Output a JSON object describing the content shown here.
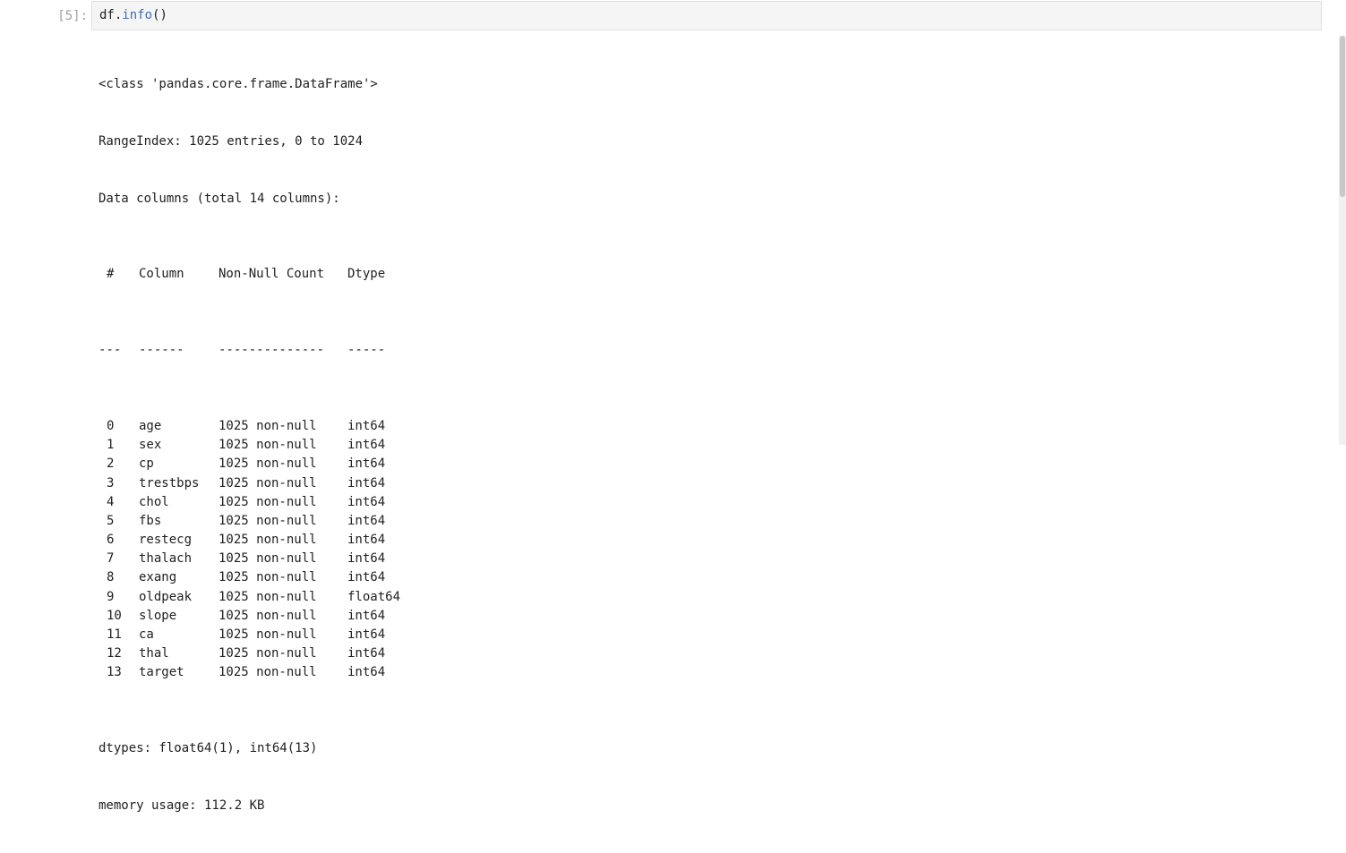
{
  "cell": {
    "prompt": "[5]:",
    "code": {
      "object": "df",
      "dot": ".",
      "method": "info",
      "parens": "()"
    }
  },
  "output": {
    "class_line": "<class 'pandas.core.frame.DataFrame'>",
    "range_line": "RangeIndex: 1025 entries, 0 to 1024",
    "columns_line": "Data columns (total 14 columns):",
    "headers": {
      "num": "#",
      "column": "Column",
      "count": "Non-Null Count",
      "dtype": "Dtype"
    },
    "separators": {
      "num": "---",
      "column": "------",
      "count": "--------------",
      "dtype": "-----"
    },
    "rows": [
      {
        "num": "0",
        "column": "age",
        "count": "1025 non-null",
        "dtype": "int64"
      },
      {
        "num": "1",
        "column": "sex",
        "count": "1025 non-null",
        "dtype": "int64"
      },
      {
        "num": "2",
        "column": "cp",
        "count": "1025 non-null",
        "dtype": "int64"
      },
      {
        "num": "3",
        "column": "trestbps",
        "count": "1025 non-null",
        "dtype": "int64"
      },
      {
        "num": "4",
        "column": "chol",
        "count": "1025 non-null",
        "dtype": "int64"
      },
      {
        "num": "5",
        "column": "fbs",
        "count": "1025 non-null",
        "dtype": "int64"
      },
      {
        "num": "6",
        "column": "restecg",
        "count": "1025 non-null",
        "dtype": "int64"
      },
      {
        "num": "7",
        "column": "thalach",
        "count": "1025 non-null",
        "dtype": "int64"
      },
      {
        "num": "8",
        "column": "exang",
        "count": "1025 non-null",
        "dtype": "int64"
      },
      {
        "num": "9",
        "column": "oldpeak",
        "count": "1025 non-null",
        "dtype": "float64"
      },
      {
        "num": "10",
        "column": "slope",
        "count": "1025 non-null",
        "dtype": "int64"
      },
      {
        "num": "11",
        "column": "ca",
        "count": "1025 non-null",
        "dtype": "int64"
      },
      {
        "num": "12",
        "column": "thal",
        "count": "1025 non-null",
        "dtype": "int64"
      },
      {
        "num": "13",
        "column": "target",
        "count": "1025 non-null",
        "dtype": "int64"
      }
    ],
    "dtypes_line": "dtypes: float64(1), int64(13)",
    "memory_line": "memory usage: 112.2 KB"
  },
  "colors": {
    "prompt": "#9e9e9e",
    "input_bg": "#f5f5f5",
    "input_border": "#e0e0e0",
    "method": "#3e6fb3",
    "text": "#212121"
  }
}
